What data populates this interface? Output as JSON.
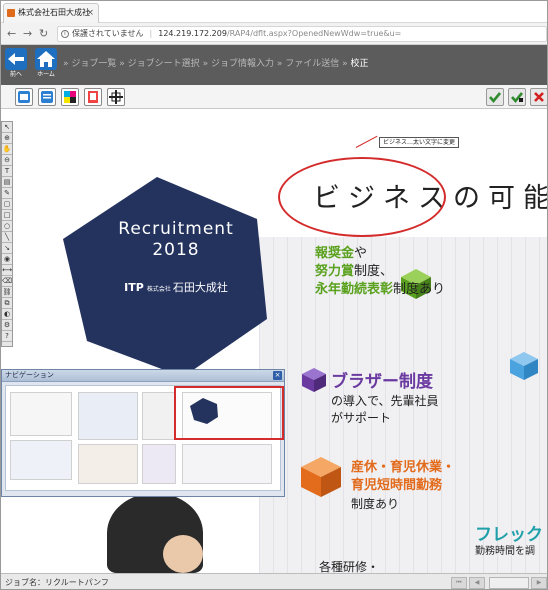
{
  "browser": {
    "tab_title": "株式会社石田大成社",
    "tab_close": "×",
    "address_security": "保護されていません",
    "address_host": "124.219.172.209",
    "address_path": "/RAP4/dflt.aspx?OpenedNewWdw=true&u="
  },
  "app_header": {
    "back_label": "前へ",
    "home_label": "ホーム",
    "breadcrumb": [
      "ジョブ一覧",
      "ジョブシート選択",
      "ジョブ情報入力",
      "ファイル送信"
    ],
    "breadcrumb_current": "校正",
    "separator": "»"
  },
  "document": {
    "hex_title_line1": "Recruitment",
    "hex_title_line2": "2018",
    "logo_itp": "ITP",
    "logo_prefix": "株式会社",
    "logo_name": "石田大成社",
    "main_heading": "ビジネスの可能性",
    "annotation_text": "ビジネス…太い文字に変更",
    "feature1_line1_a": "報奨金",
    "feature1_line1_b": "や",
    "feature1_line2_a": "努力賞",
    "feature1_line2_b": "制度、",
    "feature1_line3_a": "永年勤続表彰",
    "feature1_line3_b": "制度あり",
    "feature2_title": "ブラザー制度",
    "feature2_line2": "の導入で、先輩社員",
    "feature2_line3": "がサポート",
    "feature3_line1": "産休・育児休業・",
    "feature3_line2": "育児短時間勤務",
    "feature3_line3": "制度あり",
    "feature4_title": "フレック",
    "feature4_sub": "勤務時間を調",
    "training_text": "各種研修・"
  },
  "navigator": {
    "title": "ナビゲーション",
    "close": "×"
  },
  "status": {
    "job_label": "ジョブ名：",
    "job_name": "リクルートパンフ"
  },
  "colors": {
    "hex_navy": "#24335e",
    "green": "#5aa11e",
    "purple": "#6a3aa0",
    "orange": "#e36b1c",
    "teal": "#1f9fa8",
    "annotation_red": "#d42c2c"
  }
}
